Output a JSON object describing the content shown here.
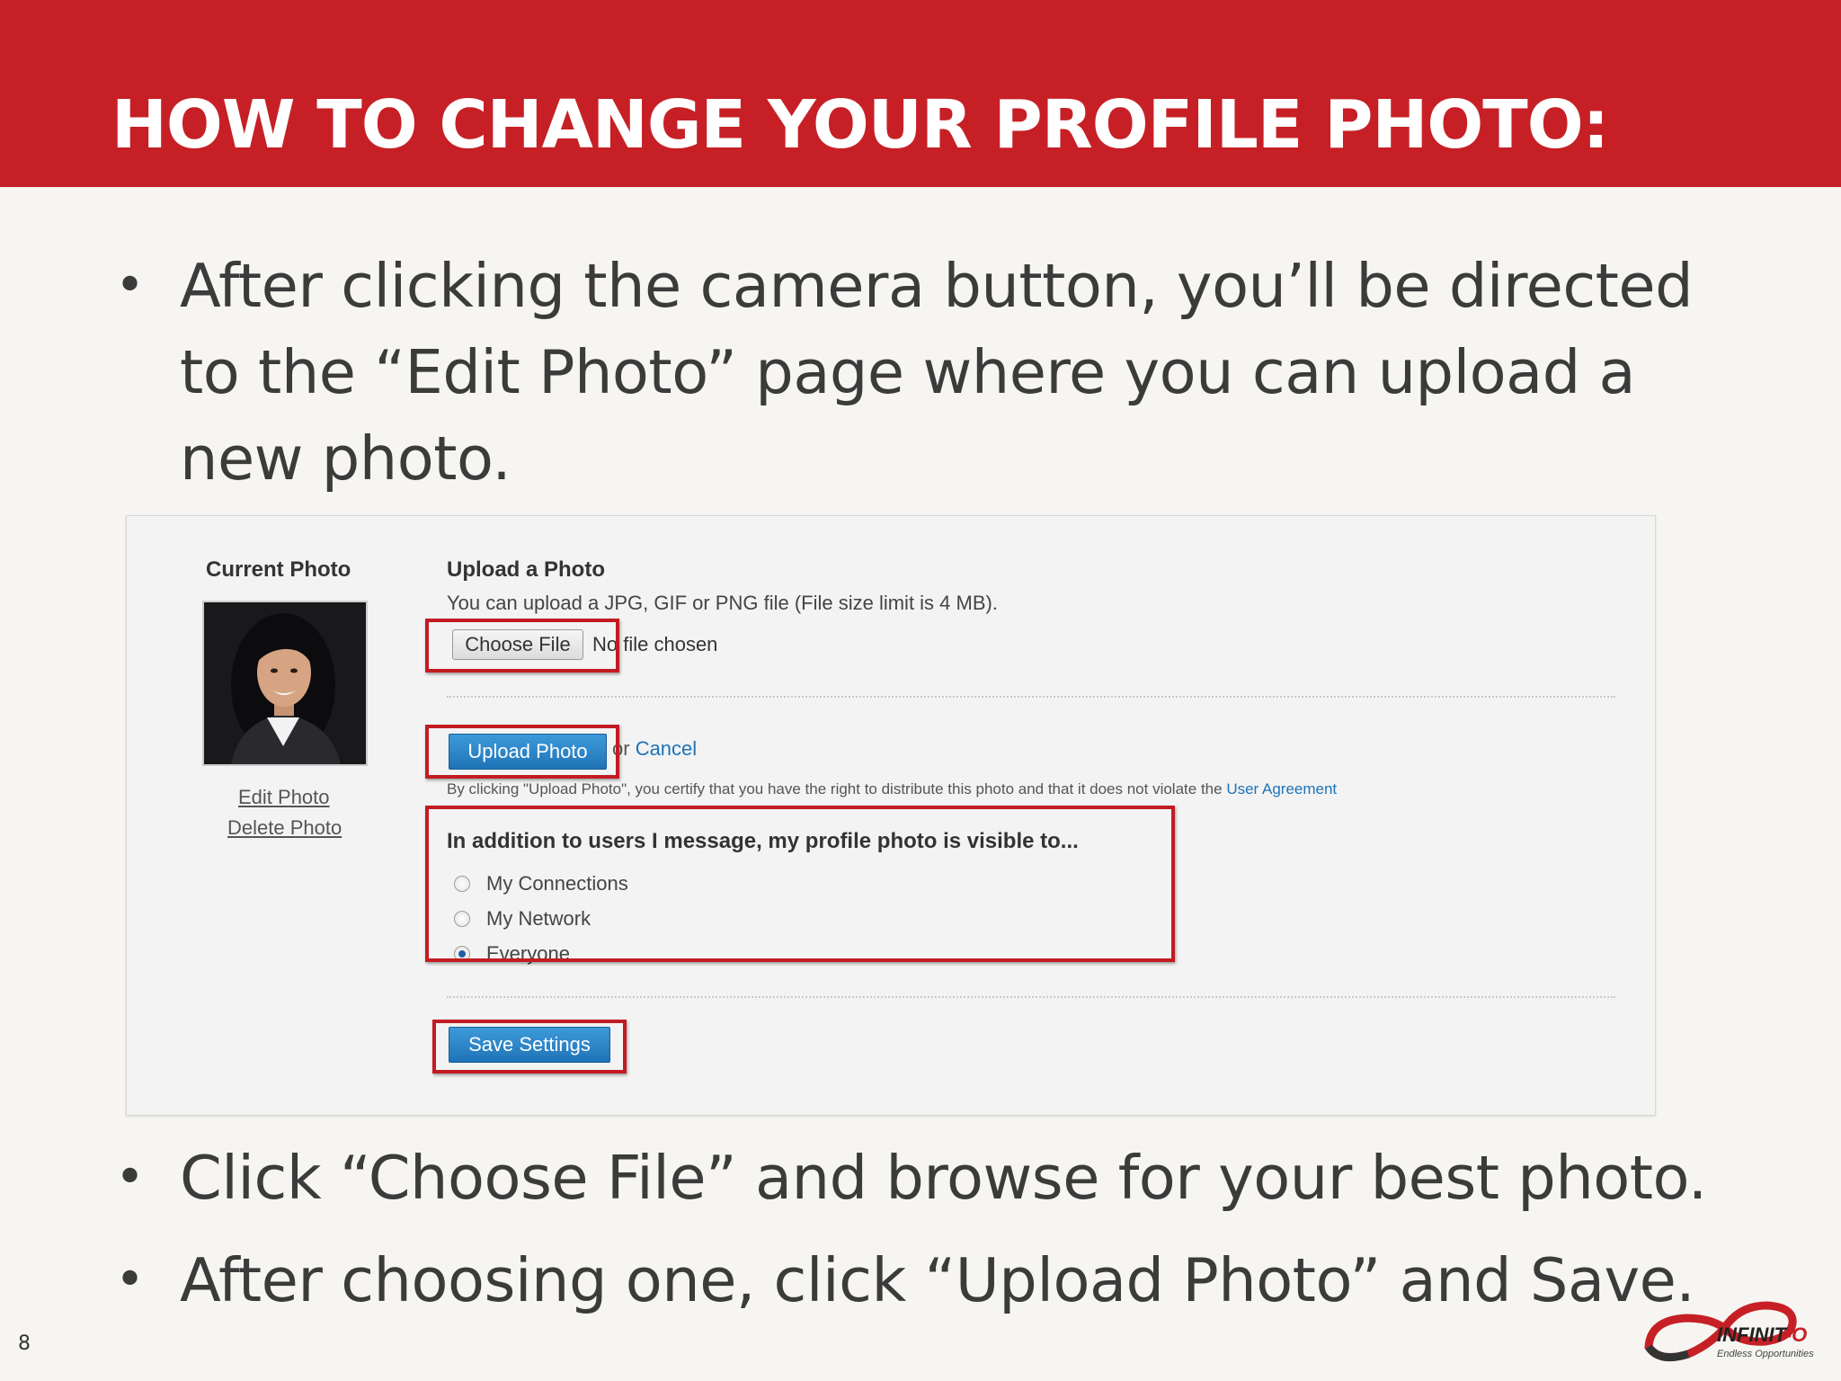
{
  "header": {
    "title": "HOW TO CHANGE YOUR PROFILE PHOTO:"
  },
  "bullets": [
    "After clicking the camera button, you’ll be directed to the “Edit Photo” page where you can upload a new photo.",
    "Click “Choose File” and browse for your best photo.",
    "After choosing one, click “Upload Photo” and Save."
  ],
  "bullet_glyph": "•",
  "screenshot": {
    "current_photo_label": "Current Photo",
    "edit_photo_link": "Edit Photo",
    "delete_photo_link": "Delete Photo",
    "upload_title": "Upload a Photo",
    "upload_desc": "You can upload a JPG, GIF or PNG file (File size limit is 4 MB).",
    "choose_file_label": "Choose File",
    "no_file_text": "No file chosen",
    "upload_button": "Upload Photo",
    "or_text": "or",
    "cancel_link": "Cancel",
    "certify_text": "By clicking \"Upload Photo\", you certify that you have the right to distribute this photo and that it does not violate the",
    "user_agreement_link": "User Agreement",
    "visibility_title": "In addition to users I message, my profile photo is visible to...",
    "visibility_options": [
      {
        "label": "My Connections",
        "selected": false
      },
      {
        "label": "My Network",
        "selected": false
      },
      {
        "label": "Everyone",
        "selected": true
      }
    ],
    "save_button": "Save Settings",
    "highlight_color": "#c31b22",
    "button_color": "#1f73b7"
  },
  "footer": {
    "page_number": "8",
    "logo_name_main": "INFINIT",
    "logo_name_dash": "-",
    "logo_name_end": "O",
    "logo_tagline": "Endless Opportunities"
  },
  "colors": {
    "header_bg": "#c62026",
    "body_bg": "#f6f5f1"
  }
}
